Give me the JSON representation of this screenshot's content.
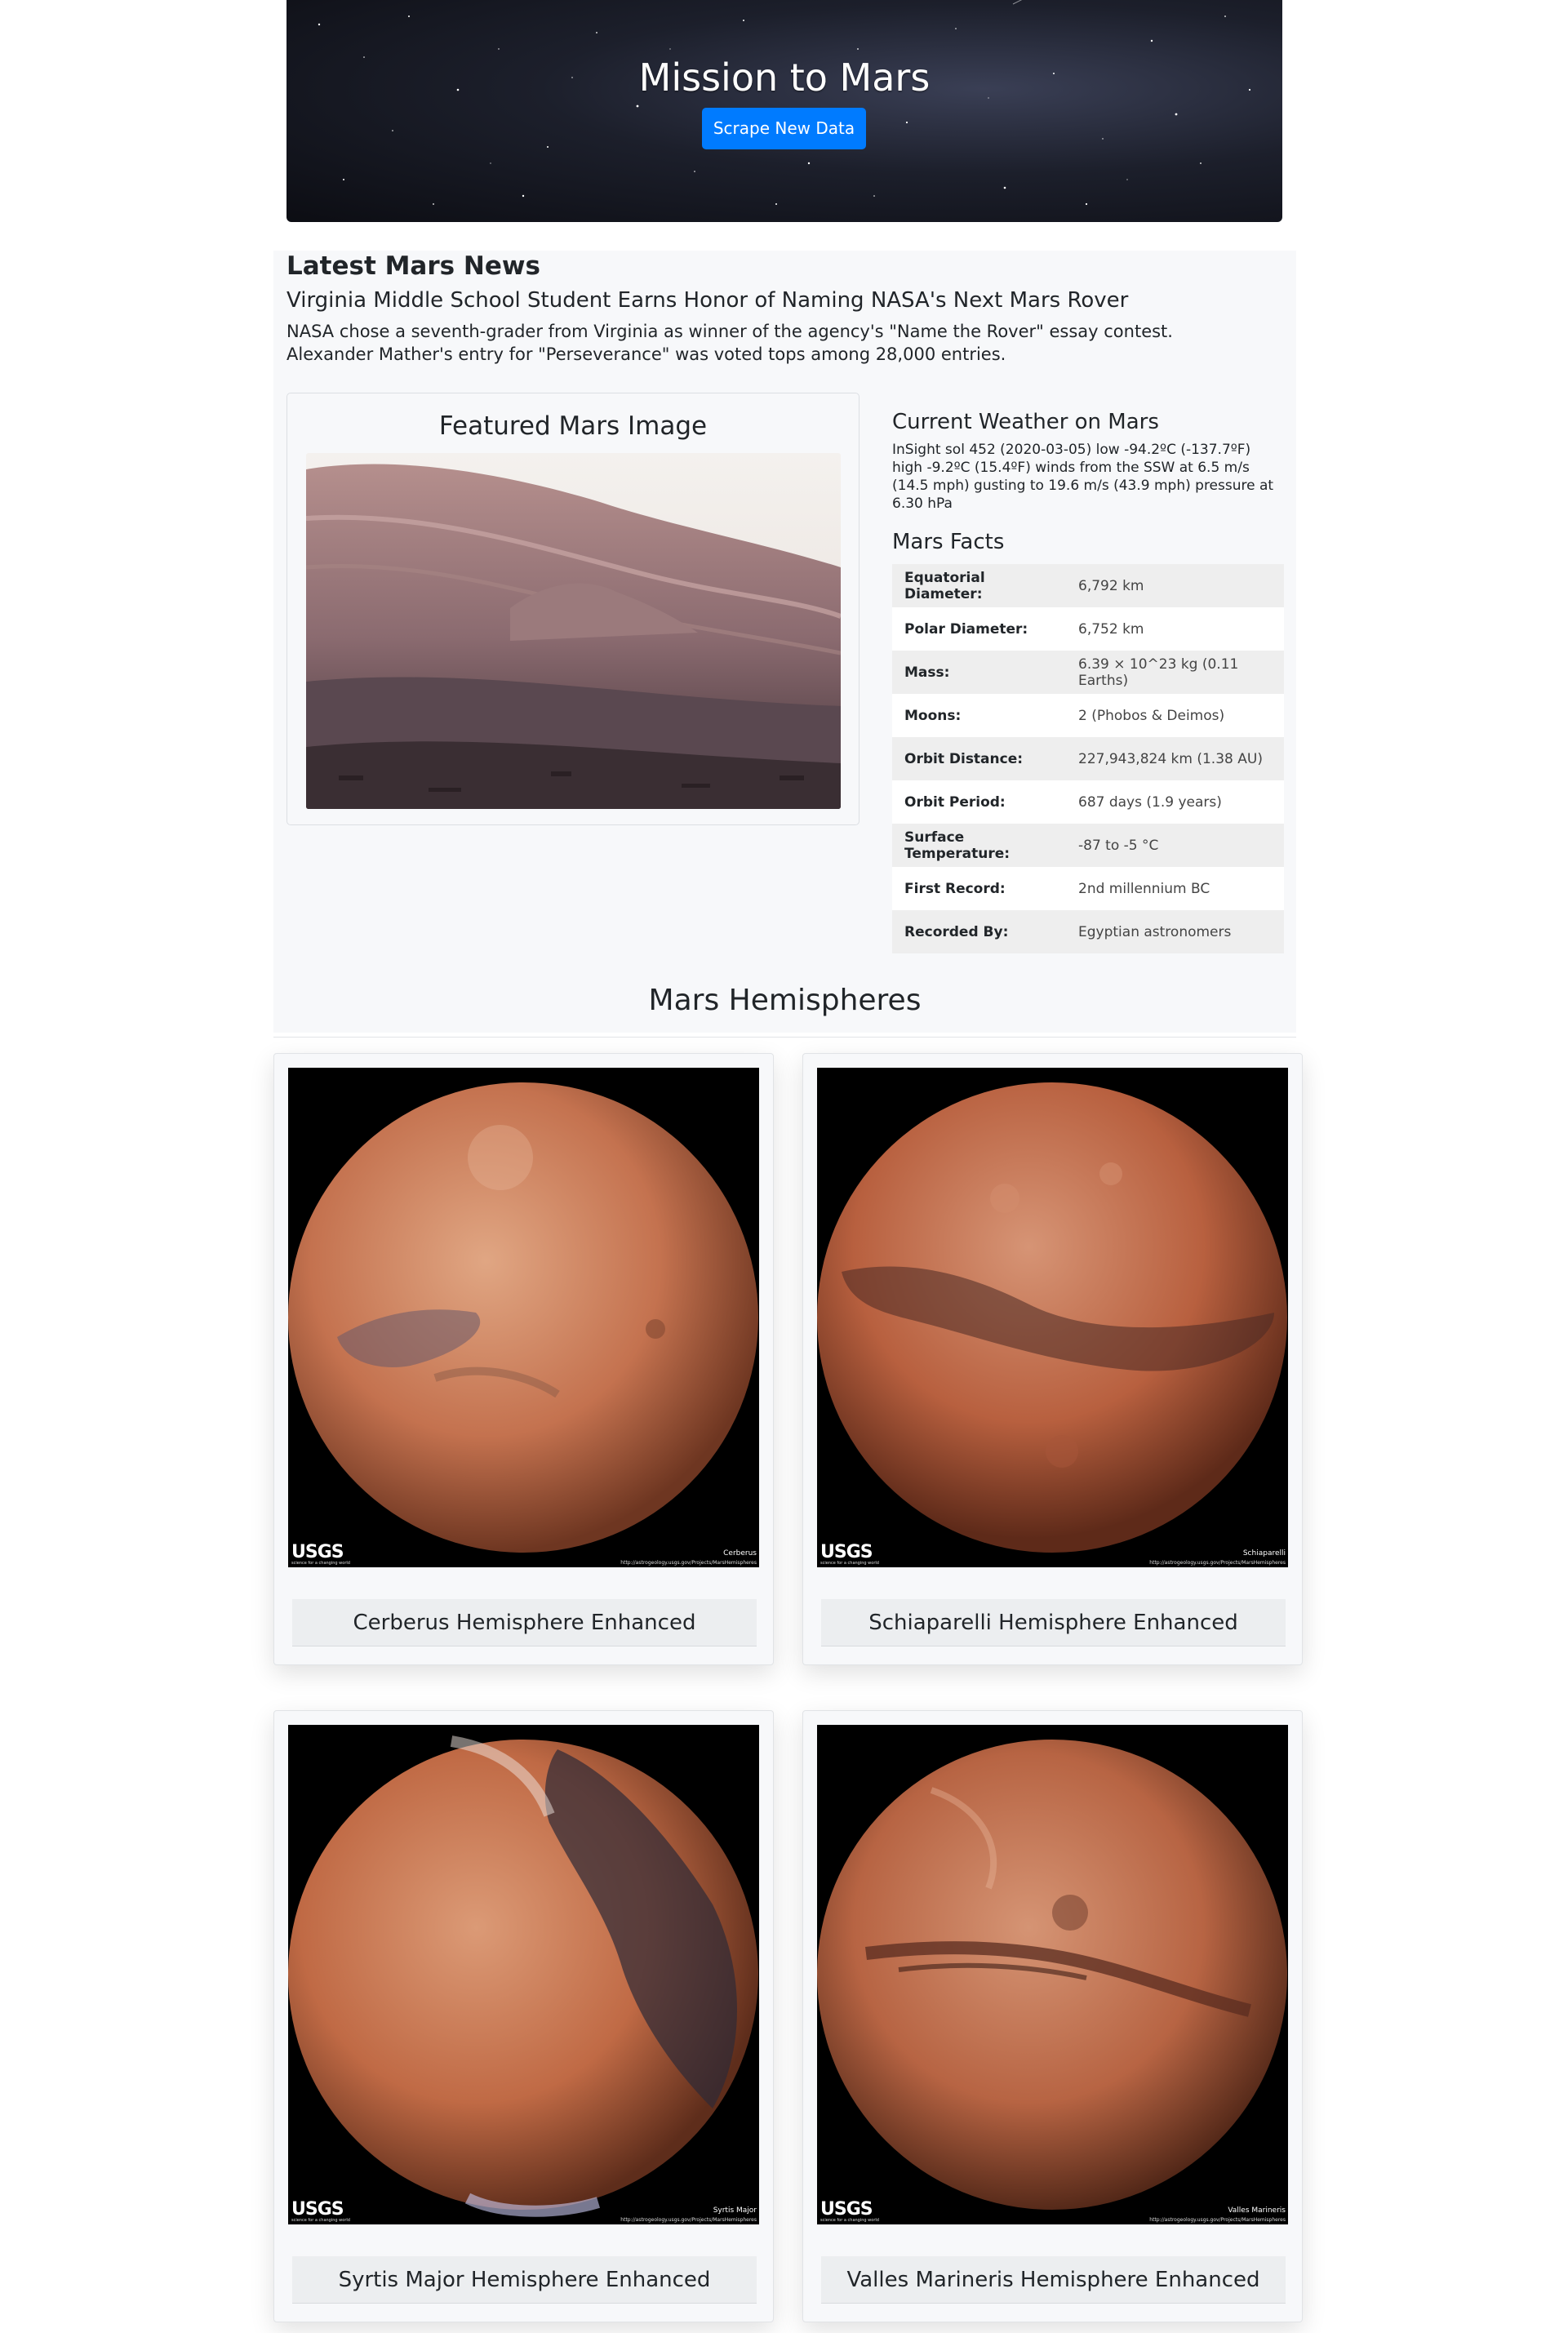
{
  "header": {
    "title": "Mission to Mars",
    "scrape_label": "Scrape New Data"
  },
  "news": {
    "heading": "Latest Mars News",
    "title": "Virginia Middle School Student Earns Honor of Naming NASA's Next Mars Rover",
    "paragraph": "NASA chose a seventh-grader from Virginia as winner of the agency's \"Name the Rover\" essay contest. Alexander Mather's entry for \"Perseverance\" was voted tops among 28,000 entries."
  },
  "featured": {
    "heading": "Featured Mars Image"
  },
  "weather": {
    "heading": "Current Weather on Mars",
    "text": "InSight sol 452 (2020-03-05) low -94.2ºC (-137.7ºF) high -9.2ºC (15.4ºF) winds from the SSW at 6.5 m/s (14.5 mph) gusting to 19.6 m/s (43.9 mph) pressure at 6.30 hPa"
  },
  "facts": {
    "heading": "Mars Facts",
    "rows": [
      {
        "key": "Equatorial Diameter:",
        "value": "6,792 km"
      },
      {
        "key": "Polar Diameter:",
        "value": "6,752 km"
      },
      {
        "key": "Mass:",
        "value": "6.39 × 10^23 kg (0.11 Earths)"
      },
      {
        "key": "Moons:",
        "value": "2 (Phobos & Deimos)"
      },
      {
        "key": "Orbit Distance:",
        "value": "227,943,824 km (1.38 AU)"
      },
      {
        "key": "Orbit Period:",
        "value": "687 days (1.9 years)"
      },
      {
        "key": "Surface Temperature:",
        "value": "-87 to -5 °C"
      },
      {
        "key": "First Record:",
        "value": "2nd millennium BC"
      },
      {
        "key": "Recorded By:",
        "value": "Egyptian astronomers"
      }
    ]
  },
  "hemispheres": {
    "heading": "Mars Hemispheres",
    "items": [
      {
        "caption": "Cerberus Hemisphere Enhanced",
        "tag": "Cerberus"
      },
      {
        "caption": "Schiaparelli Hemisphere Enhanced",
        "tag": "Schiaparelli"
      },
      {
        "caption": "Syrtis Major Hemisphere Enhanced",
        "tag": "Syrtis Major"
      },
      {
        "caption": "Valles Marineris Hemisphere Enhanced",
        "tag": "Valles Marineris"
      }
    ],
    "logo_text": "USGS",
    "logo_subtext": "science for a changing world",
    "url_text": "http://astrogeology.usgs.gov/Projects/MarsHemispheres"
  },
  "colors": {
    "button": "#007bff",
    "panel": "#f7f8fa",
    "text": "#212529"
  }
}
